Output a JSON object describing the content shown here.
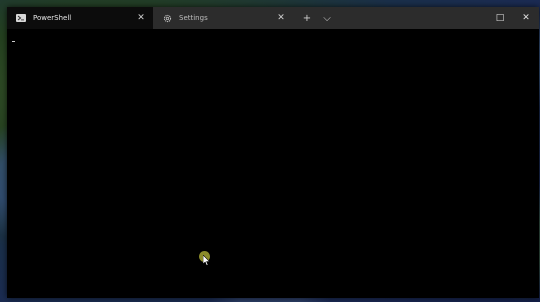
{
  "tabs": [
    {
      "label": "PowerShell",
      "icon": "powershell-icon",
      "active": true
    },
    {
      "label": "Settings",
      "icon": "gear-icon",
      "active": false
    }
  ],
  "tab_actions": {
    "new_tab": "+",
    "dropdown": "⌵"
  },
  "caption": {
    "maximize": "□",
    "close": "✕"
  },
  "icons": {
    "tab_close": "✕"
  },
  "colors": {
    "titlebar": "#2c2c2c",
    "active_tab": "#0c0c0c",
    "terminal_bg": "#000000",
    "click_indicator": "#8a8a2a"
  }
}
